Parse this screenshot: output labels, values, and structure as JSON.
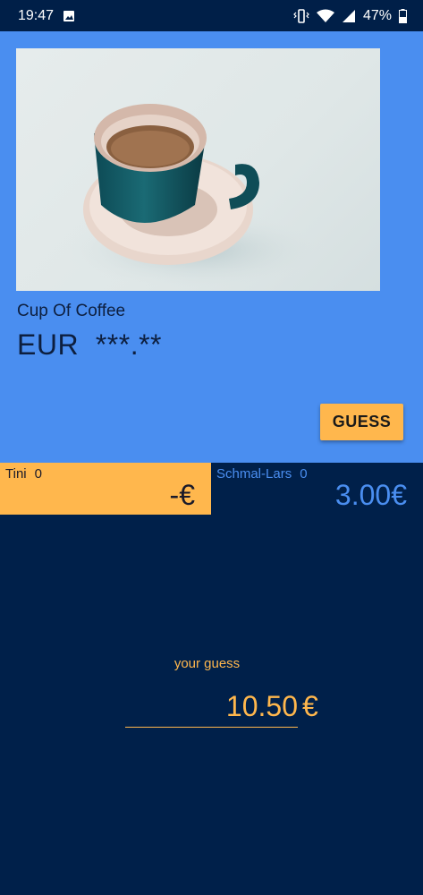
{
  "status_bar": {
    "time": "19:47",
    "battery": "47%",
    "icons": [
      "image-icon",
      "vibrate-icon",
      "wifi-icon",
      "signal-icon",
      "battery-icon"
    ]
  },
  "product": {
    "name": "Cup Of Coffee",
    "price": "EUR  ***.**",
    "image": "coffee-cup-photo"
  },
  "guess_button": {
    "label": "GUESS"
  },
  "players": [
    {
      "name": "Tini",
      "score": "0",
      "value": "-€"
    },
    {
      "name": "Schmal-Lars",
      "score": "0",
      "value": "3.00€"
    }
  ],
  "guess": {
    "label": "your guess",
    "value": "10.50",
    "currency": "€"
  },
  "colors": {
    "panel_blue": "#4a8ef0",
    "navy": "#00204a",
    "accent_orange": "#ffb74d"
  }
}
